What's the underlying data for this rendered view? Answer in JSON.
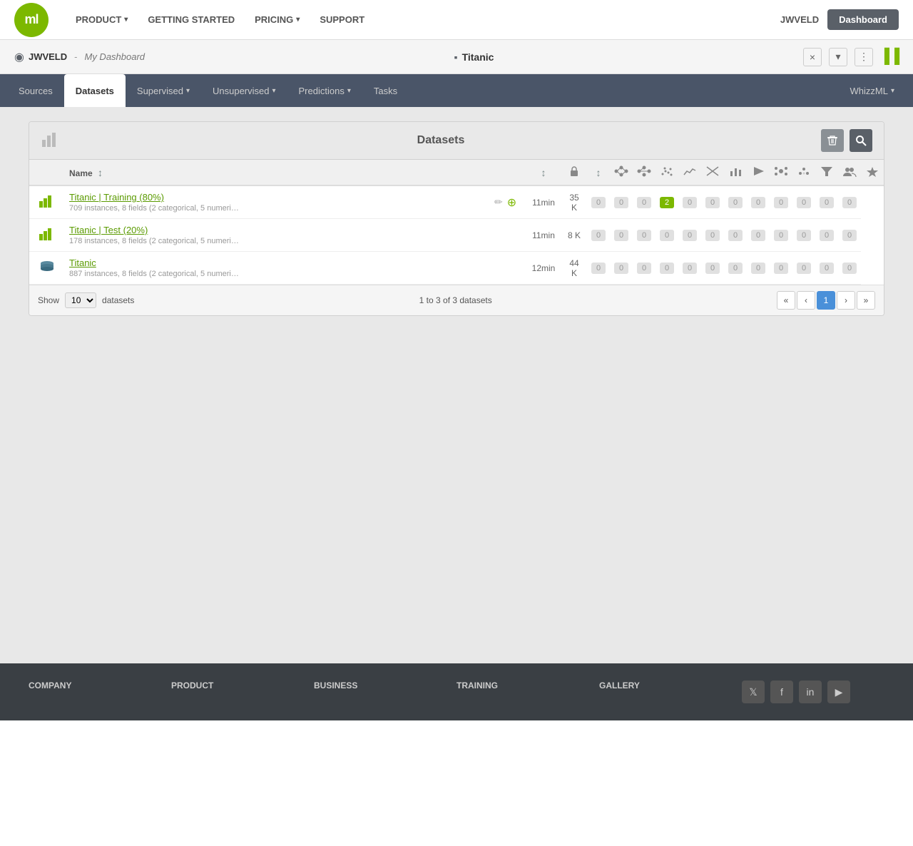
{
  "navbar": {
    "logo": "ml",
    "links": [
      {
        "label": "PRODUCT",
        "has_caret": true
      },
      {
        "label": "GETTING STARTED",
        "has_caret": false
      },
      {
        "label": "PRICING",
        "has_caret": true
      },
      {
        "label": "SUPPORT",
        "has_caret": false
      }
    ],
    "user": "JWVELD",
    "dashboard_btn": "Dashboard"
  },
  "dashboard_bar": {
    "icon": "◉",
    "user": "JWVELD",
    "separator": "-",
    "name": "My Dashboard",
    "project_icon": "▪",
    "project_name": "Titanic",
    "close_btn": "×",
    "chevron_btn": "▾",
    "dots_btn": "⋮",
    "bars_icon": "▌▐"
  },
  "tabs": [
    {
      "label": "Sources",
      "active": false
    },
    {
      "label": "Datasets",
      "active": true
    },
    {
      "label": "Supervised",
      "has_caret": true,
      "active": false
    },
    {
      "label": "Unsupervised",
      "has_caret": true,
      "active": false
    },
    {
      "label": "Predictions",
      "has_caret": true,
      "active": false
    },
    {
      "label": "Tasks",
      "active": false
    },
    {
      "label": "WhizzML",
      "has_caret": true,
      "active": false,
      "right": true
    }
  ],
  "panel": {
    "title": "Datasets",
    "title_icon": "▐▐",
    "delete_btn": "🗑",
    "search_btn": "🔍"
  },
  "table": {
    "columns": [
      {
        "label": ""
      },
      {
        "label": "Name"
      },
      {
        "label": "↕"
      },
      {
        "label": ""
      },
      {
        "label": "↕"
      },
      {
        "label": "🔒"
      },
      {
        "label": "↕"
      },
      {
        "label": "⊞"
      },
      {
        "label": "⊟"
      },
      {
        "label": "✦"
      },
      {
        "label": "✂"
      },
      {
        "label": "✕"
      },
      {
        "label": "📈"
      },
      {
        "label": "▷"
      },
      {
        "label": "⊕"
      },
      {
        "label": "◉"
      },
      {
        "label": "△"
      },
      {
        "label": "👥"
      },
      {
        "label": "✲"
      }
    ],
    "rows": [
      {
        "icon_type": "bar",
        "name": "Titanic | Training (80%)",
        "desc": "709 instances, 8 fields (2 categorical, 5 numeri…",
        "time": "11min",
        "size": "35 K",
        "counts": [
          0,
          0,
          0,
          2,
          0,
          0,
          0,
          0,
          0,
          0,
          0,
          0
        ],
        "active_idx": 3,
        "has_edit": true,
        "has_fav": true
      },
      {
        "icon_type": "bar",
        "name": "Titanic | Test (20%)",
        "desc": "178 instances, 8 fields (2 categorical, 5 numeri…",
        "time": "11min",
        "size": "8 K",
        "counts": [
          0,
          0,
          0,
          0,
          0,
          0,
          0,
          0,
          0,
          0,
          0,
          0
        ],
        "active_idx": -1,
        "has_edit": false,
        "has_fav": false
      },
      {
        "icon_type": "db",
        "name": "Titanic",
        "desc": "887 instances, 8 fields (2 categorical, 5 numeri…",
        "time": "12min",
        "size": "44 K",
        "counts": [
          0,
          0,
          0,
          0,
          0,
          0,
          0,
          0,
          0,
          0,
          0,
          0
        ],
        "active_idx": -1,
        "has_edit": false,
        "has_fav": false
      }
    ]
  },
  "pagination": {
    "show_label": "Show",
    "show_value": "10",
    "datasets_label": "datasets",
    "info": "1 to 3 of 3 datasets",
    "current_page": 1,
    "first_btn": "«",
    "prev_btn": "‹",
    "next_btn": "›",
    "last_btn": "»"
  },
  "footer": {
    "cols": [
      {
        "heading": "COMPANY",
        "links": []
      },
      {
        "heading": "PRODUCT",
        "links": []
      },
      {
        "heading": "BUSINESS",
        "links": []
      },
      {
        "heading": "TRAINING",
        "links": []
      },
      {
        "heading": "GALLERY",
        "links": []
      }
    ],
    "social": [
      "𝕏",
      "f",
      "in",
      "▶"
    ]
  }
}
